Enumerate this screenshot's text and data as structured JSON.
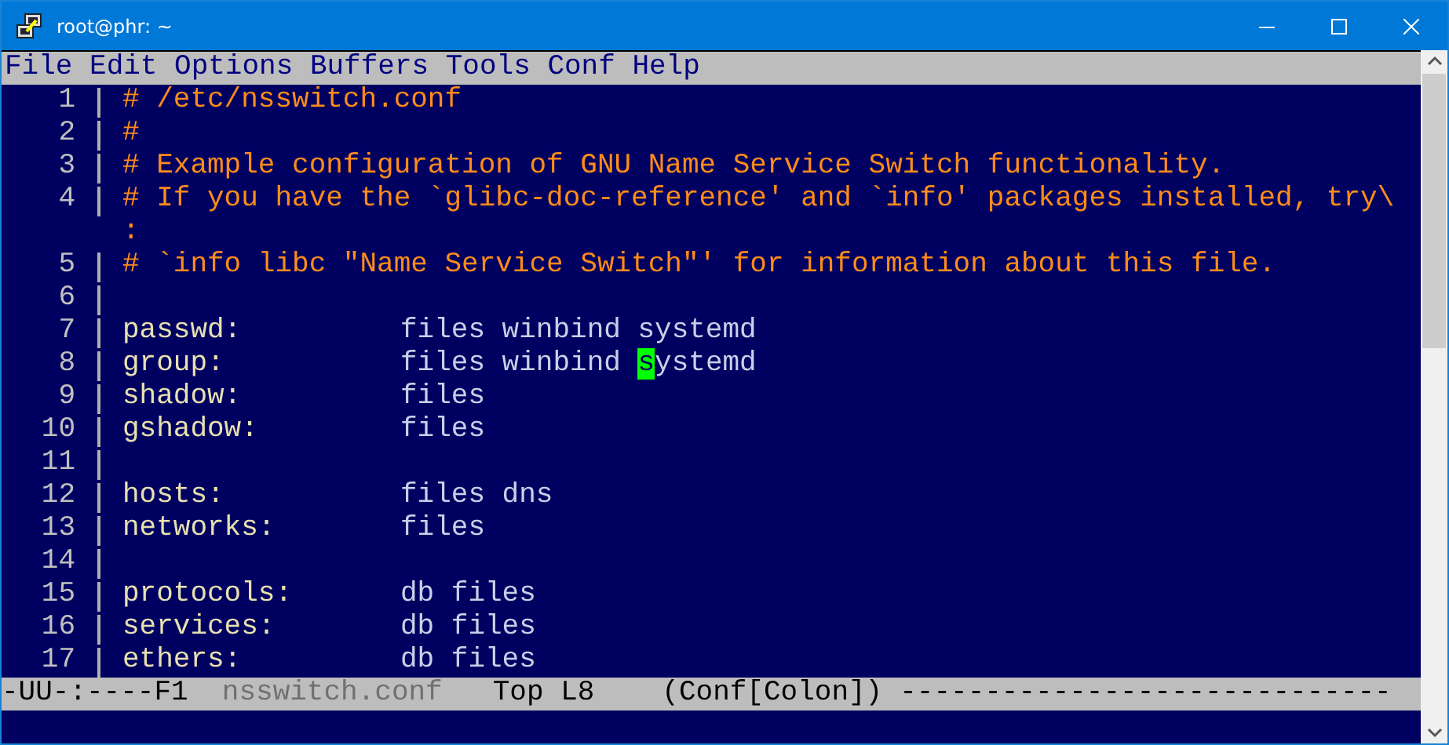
{
  "window": {
    "title": "root@phr: ~"
  },
  "menu": [
    "File",
    "Edit",
    "Options",
    "Buffers",
    "Tools",
    "Conf",
    "Help"
  ],
  "rows": [
    {
      "kind": "comment",
      "number": "1",
      "text": "# /etc/nsswitch.conf"
    },
    {
      "kind": "comment",
      "number": "2",
      "text": "#"
    },
    {
      "kind": "comment",
      "number": "3",
      "text": "# Example configuration of GNU Name Service Switch functionality."
    },
    {
      "kind": "comment",
      "number": "4",
      "text": "# If you have the `glibc-doc-reference' and `info' packages installed, try\\"
    },
    {
      "kind": "continuation",
      "text": ":"
    },
    {
      "kind": "comment",
      "number": "5",
      "text": "# `info libc \"Name Service Switch\"' for information about this file."
    },
    {
      "kind": "blank",
      "number": "6"
    },
    {
      "kind": "entry",
      "number": "7",
      "key": "passwd:",
      "value": "files winbind systemd"
    },
    {
      "kind": "cursor-entry",
      "number": "8",
      "key": "group:",
      "value": "files winbind ",
      "cursor_char": "s",
      "value_rest": "ystemd"
    },
    {
      "kind": "entry",
      "number": "9",
      "key": "shadow:",
      "value": "files"
    },
    {
      "kind": "entry",
      "number": "10",
      "key": "gshadow:",
      "value": "files"
    },
    {
      "kind": "blank",
      "number": "11"
    },
    {
      "kind": "entry",
      "number": "12",
      "key": "hosts:",
      "value": "files dns"
    },
    {
      "kind": "entry",
      "number": "13",
      "key": "networks:",
      "value": "files"
    },
    {
      "kind": "blank",
      "number": "14"
    },
    {
      "kind": "entry",
      "number": "15",
      "key": "protocols:",
      "value": "db files"
    },
    {
      "kind": "entry",
      "number": "16",
      "key": "services:",
      "value": "db files"
    },
    {
      "kind": "entry",
      "number": "17",
      "key": "ethers:",
      "value": "db files"
    }
  ],
  "mode_line": {
    "status": "-UU-:----F1",
    "buffer": "nsswitch.conf",
    "position": "Top L8",
    "mode": "(Conf[Colon])",
    "fill": "-----------------------------"
  }
}
